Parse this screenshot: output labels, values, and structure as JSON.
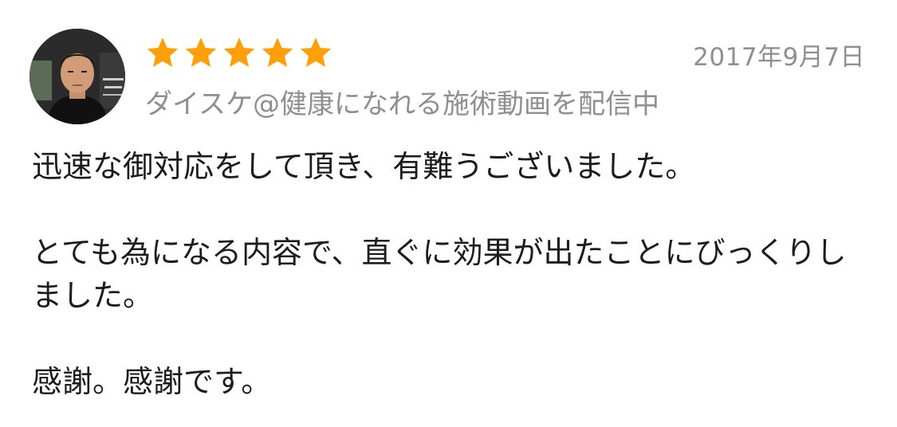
{
  "review": {
    "rating": 5,
    "max_rating": 5,
    "star_color": "#ff9f0a",
    "date": "2017年9月7日",
    "reviewer_name": "ダイスケ@健康になれる施術動画を配信中",
    "avatar_alt": "reviewer-avatar-photo",
    "body": {
      "paragraph_1": "迅速な御対応をして頂き、有難うございました。",
      "paragraph_2": "とても為になる内容で、直ぐに効果が出たことにびっくりしました。",
      "paragraph_3": "感謝。感謝です。"
    }
  }
}
